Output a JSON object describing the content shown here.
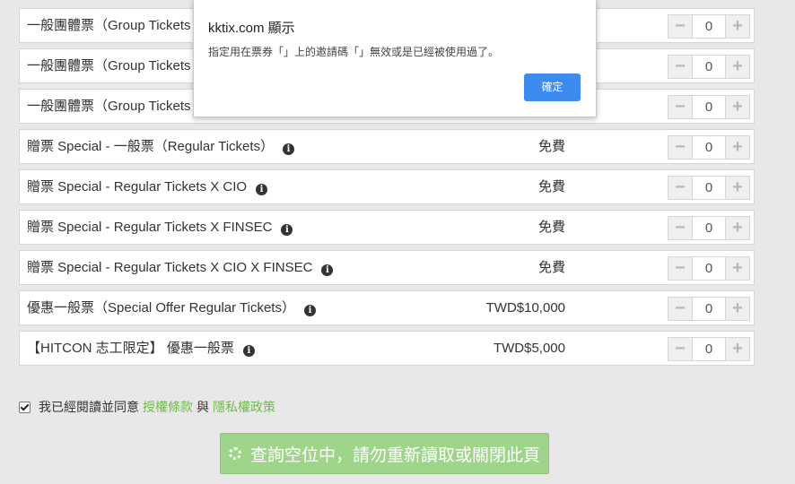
{
  "dialog": {
    "title": "kktix.com 顯示",
    "message": "指定用在票券「」上的邀請碼「」無效或是已經被使用過了。",
    "ok_label": "確定"
  },
  "tickets": [
    {
      "name": "一般團體票（Group Tickets",
      "price": "",
      "qty": "0",
      "info": false
    },
    {
      "name": "一般團體票（Group Tickets",
      "price": "",
      "qty": "0",
      "info": false
    },
    {
      "name": "一般團體票（Group Tickets",
      "price": "",
      "qty": "0",
      "info": false
    },
    {
      "name": "贈票 Special - 一般票（Regular Tickets）",
      "price": "免費",
      "qty": "0",
      "info": true
    },
    {
      "name": "贈票 Special - Regular Tickets X CIO",
      "price": "免費",
      "qty": "0",
      "info": true
    },
    {
      "name": "贈票 Special - Regular Tickets X FINSEC",
      "price": "免費",
      "qty": "0",
      "info": true
    },
    {
      "name": "贈票 Special - Regular Tickets X CIO X FINSEC",
      "price": "免費",
      "qty": "0",
      "info": true
    },
    {
      "name": "優惠一般票（Special Offer Regular Tickets）",
      "price": "TWD$10,000",
      "qty": "0",
      "info": true
    },
    {
      "name": "【HITCON 志工限定】 優惠一般票",
      "price": "TWD$5,000",
      "qty": "0",
      "info": true
    }
  ],
  "stepper": {
    "minus": "−",
    "plus": "+"
  },
  "info_glyph": "i",
  "agree": {
    "checked": true,
    "text": "我已經閱讀並同意",
    "terms_link": "授權條款",
    "and": "與",
    "privacy_link": "隱私權政策"
  },
  "submit": {
    "label": "查詢空位中，請勿重新讀取或關閉此頁"
  },
  "colors": {
    "link": "#6fbb4c",
    "submit_bg": "#9fd48b",
    "dialog_ok": "#3c8cf0"
  }
}
